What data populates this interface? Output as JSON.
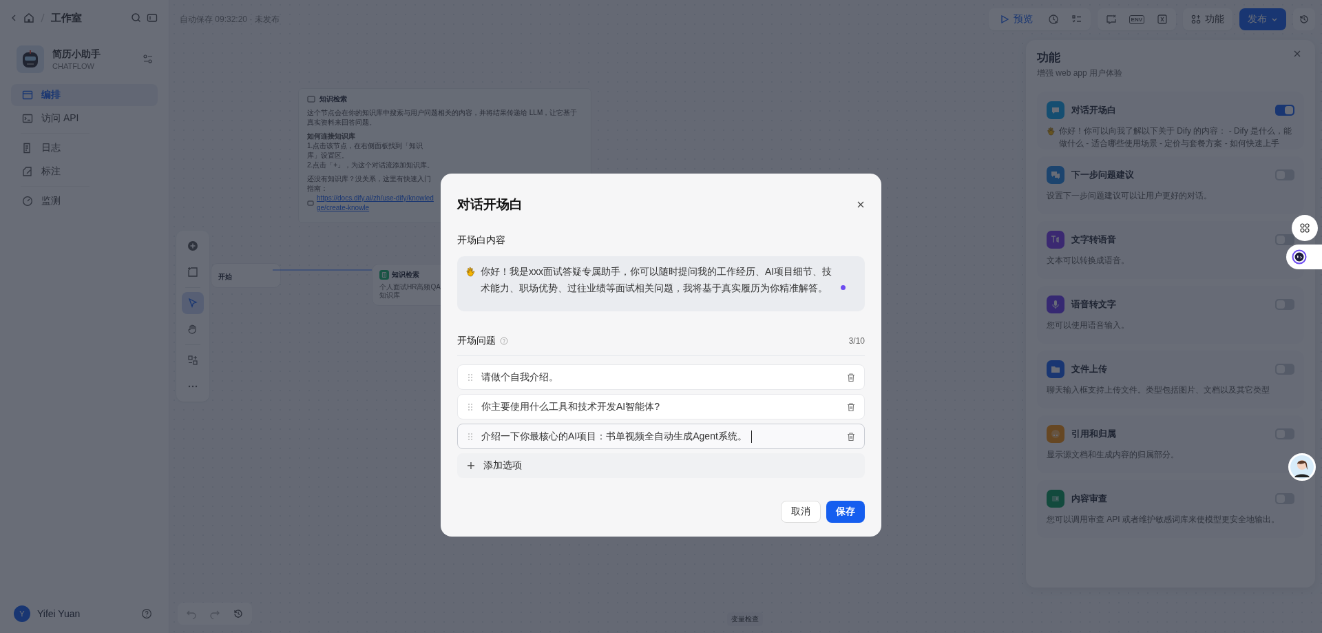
{
  "topbar": {
    "breadcrumb": "工作室",
    "autosave": "自动保存 09:32:20 · 未发布",
    "preview": "预览",
    "env": "ENV",
    "features": "功能",
    "publish": "发布"
  },
  "app": {
    "name": "简历小助手",
    "type": "CHATFLOW"
  },
  "nav": [
    {
      "kind": "orchestrate",
      "label": "编排",
      "selected": true
    },
    {
      "kind": "api",
      "label": "访问 API",
      "selected": false
    },
    {
      "kind": "logs",
      "label": "日志",
      "selected": false
    },
    {
      "kind": "annotate",
      "label": "标注",
      "selected": false
    },
    {
      "kind": "monitor",
      "label": "监测",
      "selected": false
    }
  ],
  "user": {
    "initial": "Y",
    "name": "Yifei Yuan"
  },
  "canvas": {
    "note": {
      "title": "知识检索",
      "paragraphs": [
        {
          "kind": "text",
          "text": "这个节点会在你的知识库中搜索与用户问题相关的内容，并将结果传递给 LLM，让它基于真实资料来回答问题。"
        },
        {
          "kind": "heading",
          "text": "如何连接知识库"
        },
        {
          "kind": "line",
          "text": "1.点击该节点，在右侧面板找到「知识库」设置区。"
        },
        {
          "kind": "line",
          "text": "2.点击「+」，为这个对话流添加知识库。"
        },
        {
          "kind": "text",
          "text": "还没有知识库？没关系，这里有快速入门指南："
        },
        {
          "kind": "link",
          "text": "https://docs.dify.ai/zh/use-dify/knowledge/create-knowle"
        }
      ]
    },
    "nodes": [
      {
        "kind": "start",
        "title": "开始"
      },
      {
        "kind": "knowledge",
        "title": "知识检索",
        "subtitle": "个人面试HR高频QA知识库"
      }
    ],
    "tools": [
      {
        "kind": "add",
        "selected": false
      },
      {
        "kind": "note",
        "selected": false
      },
      {
        "kind": "pointer",
        "selected": true
      },
      {
        "kind": "hand",
        "selected": false
      },
      {
        "kind": "organize",
        "selected": false
      },
      {
        "kind": "more",
        "selected": false
      }
    ],
    "variable_check": "变量检查"
  },
  "features_panel": {
    "title": "功能",
    "subtitle": "增强 web app 用户体验",
    "items": [
      {
        "kind": "opener",
        "title": "对话开场白",
        "description": "你好！你可以向我了解以下关于 Dify 的内容： - Dify 是什么，能做什么 - 适合哪些使用场景 - 定价与套餐方案 - 如何快速上手",
        "wave": true,
        "on": true
      },
      {
        "kind": "suggest",
        "title": "下一步问题建议",
        "description": "设置下一步问题建议可以让用户更好的对话。",
        "wave": false,
        "on": false
      },
      {
        "kind": "tts",
        "title": "文字转语音",
        "description": "文本可以转换成语音。",
        "wave": false,
        "on": false
      },
      {
        "kind": "stt",
        "title": "语音转文字",
        "description": "您可以使用语音输入。",
        "wave": false,
        "on": false
      },
      {
        "kind": "upload",
        "title": "文件上传",
        "description": "聊天输入框支持上传文件。类型包括图片、文档以及其它类型",
        "wave": false,
        "on": false
      },
      {
        "kind": "citation",
        "title": "引用和归属",
        "description": "显示源文档和生成内容的归属部分。",
        "wave": false,
        "on": false
      },
      {
        "kind": "moderation",
        "title": "内容审查",
        "description": "您可以调用审查 API 或者维护敏感词库来使模型更安全地输出。",
        "wave": false,
        "on": false
      }
    ]
  },
  "dialog": {
    "title": "对话开场白",
    "content_label": "开场白内容",
    "content": "你好！我是xxx面试答疑专属助手，你可以随时提问我的工作经历、AI项目细节、技术能力、职场优势、过往业绩等面试相关问题，我将基于真实履历为你精准解答。",
    "questions_label": "开场问题",
    "count": "3/10",
    "questions": [
      {
        "text": "请做个自我介绍。",
        "focused": false
      },
      {
        "text": "你主要使用什么工具和技术开发AI智能体?",
        "focused": false
      },
      {
        "text": "介绍一下你最核心的AI项目：书单视频全自动生成Agent系统。",
        "focused": true
      }
    ],
    "add_option": "添加选项",
    "cancel": "取消",
    "save": "保存"
  }
}
